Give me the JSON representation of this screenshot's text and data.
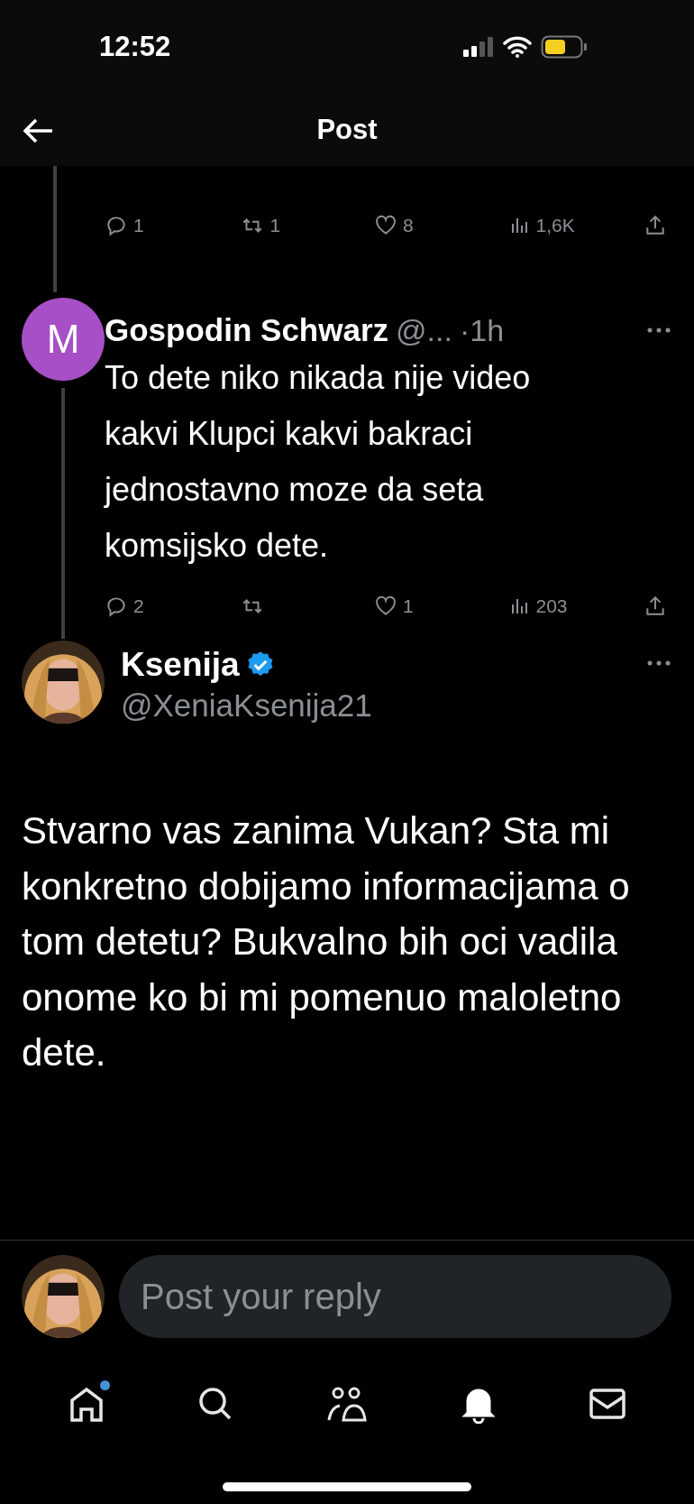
{
  "status_bar": {
    "time": "12:52"
  },
  "header": {
    "title": "Post"
  },
  "thread": [
    {
      "kind": "clipped",
      "actions": {
        "replies": "1",
        "reposts": "1",
        "likes": "8",
        "views": "1,6K"
      }
    },
    {
      "kind": "reply",
      "avatar_letter": "M",
      "name": "Gospodin Schwarz",
      "handle": "@...",
      "time": "·1h",
      "text": "To dete niko nikada nije video kakvi Klupci kakvi bakraci  jednostavno moze da seta komsijsko dete.",
      "actions": {
        "replies": "2",
        "likes": "1",
        "views": "203"
      }
    }
  ],
  "main_post": {
    "name": "Ksenija",
    "verified": true,
    "handle": "@XeniaKsenija21",
    "text": "Stvarno vas zanima Vukan? Sta mi konkretno dobijamo informacijama o tom detetu? Bukvalno bih oci vadila onome ko bi mi pomenuo maloletno dete."
  },
  "reply_bar": {
    "placeholder": "Post your reply"
  },
  "nav": [
    {
      "kind": "home",
      "selected": false,
      "badge": true
    },
    {
      "kind": "search",
      "selected": false
    },
    {
      "kind": "communities",
      "selected": false
    },
    {
      "kind": "notifications",
      "selected": true
    },
    {
      "kind": "messages",
      "selected": false
    }
  ]
}
